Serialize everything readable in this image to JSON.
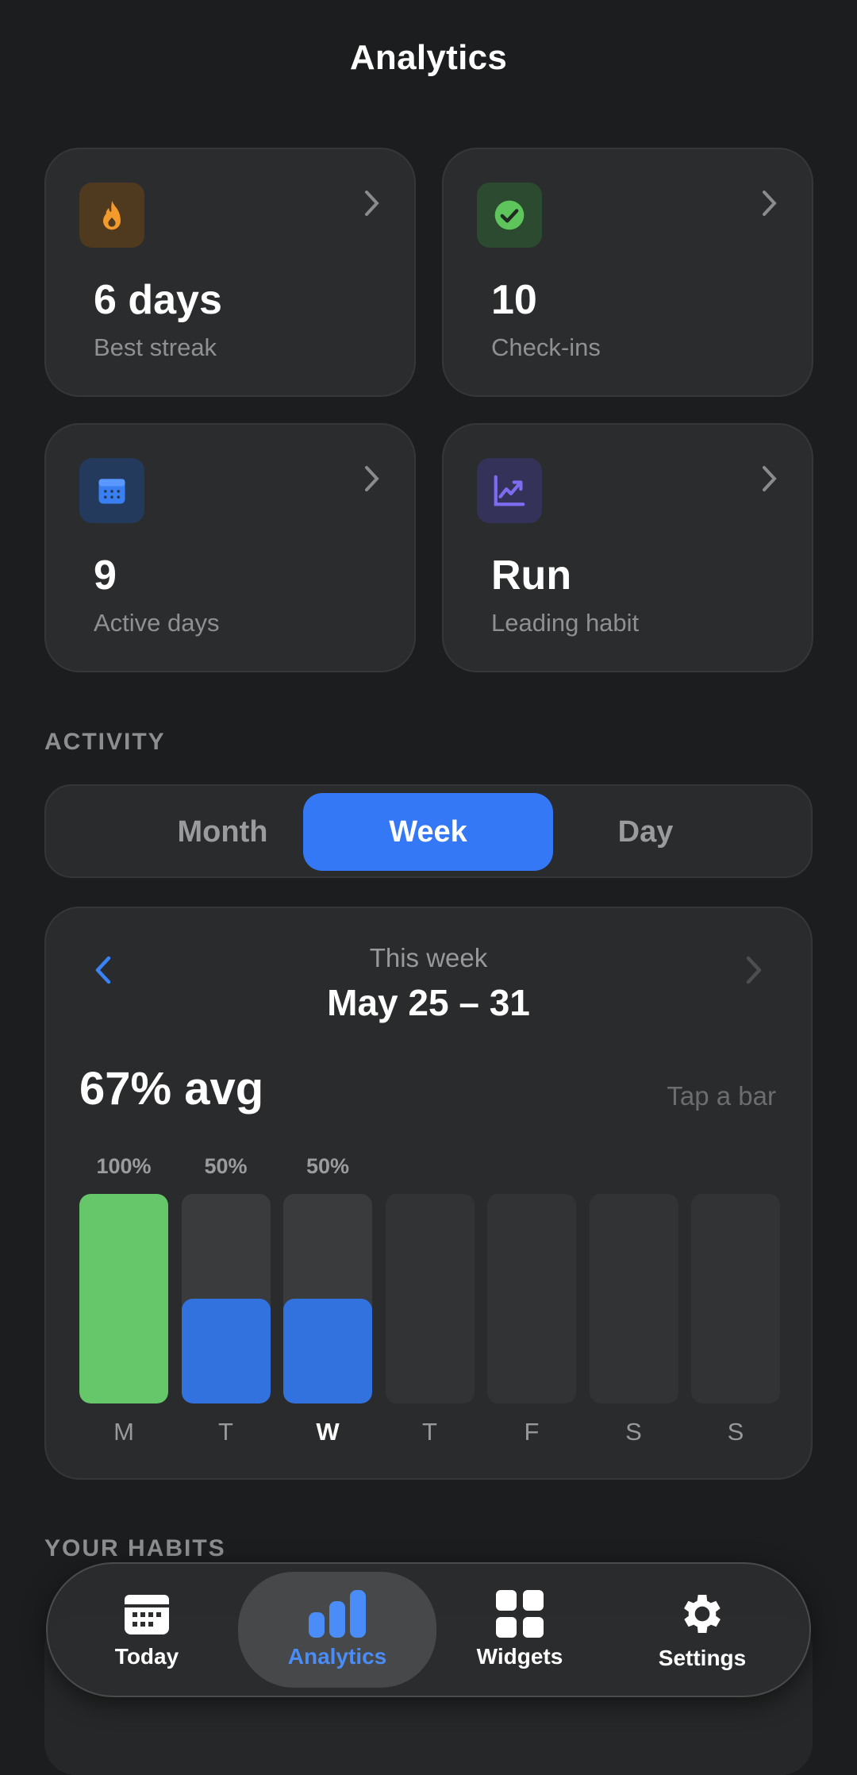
{
  "header": {
    "title": "Analytics"
  },
  "stats": [
    {
      "value": "6 days",
      "label": "Best streak",
      "icon": "flame-icon",
      "color": "#f39a2d"
    },
    {
      "value": "10",
      "label": "Check-ins",
      "icon": "checkmark-circle-icon",
      "color": "#5dc55c"
    },
    {
      "value": "9",
      "label": "Active days",
      "icon": "calendar-icon",
      "color": "#3a7ff2"
    },
    {
      "value": "Run",
      "label": "Leading habit",
      "icon": "trend-up-chart-icon",
      "color": "#6c5ce7"
    }
  ],
  "activity": {
    "section_label": "ACTIVITY",
    "segments": [
      {
        "label": "Month",
        "selected": false
      },
      {
        "label": "Week",
        "selected": true
      },
      {
        "label": "Day",
        "selected": false
      }
    ],
    "period_label": "This week",
    "period_range": "May 25 – 31",
    "average": "67% avg",
    "hint": "Tap a bar"
  },
  "chart_data": {
    "type": "bar",
    "categories": [
      "M",
      "T",
      "W",
      "T",
      "F",
      "S",
      "S"
    ],
    "values": [
      100,
      50,
      50,
      null,
      null,
      null,
      null
    ],
    "value_labels": [
      "100%",
      "50%",
      "50%",
      "",
      "",
      "",
      ""
    ],
    "ylim": [
      0,
      100
    ],
    "highlighted_category_index": 2,
    "colors": {
      "complete": "#66c66a",
      "partial": "#3272df",
      "track": "#3a3b3c",
      "empty": "#323334"
    }
  },
  "habits": {
    "section_label": "YOUR HABITS"
  },
  "tabbar": {
    "items": [
      {
        "label": "Today",
        "icon": "calendar-icon",
        "active": false
      },
      {
        "label": "Analytics",
        "icon": "bar-chart-icon",
        "active": true
      },
      {
        "label": "Widgets",
        "icon": "grid-icon",
        "active": false
      },
      {
        "label": "Settings",
        "icon": "gear-icon",
        "active": false
      }
    ],
    "accent": "#4a8df8"
  }
}
